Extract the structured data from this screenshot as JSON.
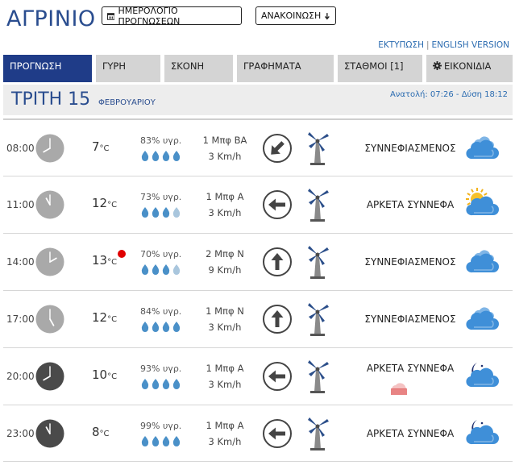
{
  "header": {
    "city": "ΑΓΡΙΝΙΟ",
    "calendar_button": "ΗΜΕΡΟΛΟΓΙΟ ΠΡΟΓΝΩΣΕΩΝ",
    "announce_button": "ΑΝΑΚΟΙΝΩΣΗ",
    "print_link": "ΕΚΤΥΠΩΣΗ",
    "separator": "|",
    "english_link": "ENGLISH VERSION"
  },
  "tabs": [
    {
      "label": "ΠΡΟΓΝΩΣΗ",
      "icon": "",
      "active": true
    },
    {
      "label": "ΓΥΡΗ",
      "icon": "",
      "active": false
    },
    {
      "label": "ΣΚΟΝΗ",
      "icon": "",
      "active": false
    },
    {
      "label": "ΓΡΑΦΗΜΑΤΑ",
      "icon": "",
      "active": false
    },
    {
      "label": "ΣΤΑΘΜΟΙ  [1]",
      "icon": "",
      "active": false
    },
    {
      "label": "ΕΙΚΟΝΙΔΙΑ",
      "icon": "gear-icon",
      "active": false
    }
  ],
  "day": {
    "name": "ΤΡΙΤΗ 15",
    "month": "ΦΕΒΡΟΥΑΡΙΟΥ",
    "sun": "Ανατολή: 07:26 - Δύση 18:12"
  },
  "temp_unit": "°C",
  "rows": [
    {
      "time": "08:00",
      "night": false,
      "temp": "7",
      "alert": false,
      "humidity": "83% υγρ.",
      "drops_full": 4,
      "wind_force": "1 Μπφ ΒΑ",
      "wind_speed": "3 Km/h",
      "arrow_icon": "arrow-southwest-icon",
      "condition": "ΣΥΝΝΕΦΙΑΣΜΕΝΟΣ",
      "haze": false,
      "weather_icon": "cloudy-icon"
    },
    {
      "time": "11:00",
      "night": false,
      "temp": "12",
      "alert": false,
      "humidity": "73% υγρ.",
      "drops_full": 3,
      "wind_force": "1 Μπφ Α",
      "wind_speed": "3 Km/h",
      "arrow_icon": "arrow-west-icon",
      "condition": "ΑΡΚΕΤΑ ΣΥΝΝΕΦΑ",
      "haze": false,
      "weather_icon": "sun-cloud-icon"
    },
    {
      "time": "14:00",
      "night": false,
      "temp": "13",
      "alert": true,
      "humidity": "70% υγρ.",
      "drops_full": 3,
      "wind_force": "2 Μπφ Ν",
      "wind_speed": "9 Km/h",
      "arrow_icon": "arrow-north-icon",
      "condition": "ΣΥΝΝΕΦΙΑΣΜΕΝΟΣ",
      "haze": false,
      "weather_icon": "cloudy-icon"
    },
    {
      "time": "17:00",
      "night": false,
      "temp": "12",
      "alert": false,
      "humidity": "84% υγρ.",
      "drops_full": 4,
      "wind_force": "1 Μπφ Ν",
      "wind_speed": "3 Km/h",
      "arrow_icon": "arrow-north-icon",
      "condition": "ΣΥΝΝΕΦΙΑΣΜΕΝΟΣ",
      "haze": false,
      "weather_icon": "cloudy-icon"
    },
    {
      "time": "20:00",
      "night": true,
      "temp": "10",
      "alert": false,
      "humidity": "93% υγρ.",
      "drops_full": 4,
      "wind_force": "1 Μπφ Α",
      "wind_speed": "3 Km/h",
      "arrow_icon": "arrow-west-icon",
      "condition": "ΑΡΚΕΤΑ ΣΥΝΝΕΦΑ",
      "haze": true,
      "weather_icon": "moon-cloud-icon"
    },
    {
      "time": "23:00",
      "night": true,
      "temp": "8",
      "alert": false,
      "humidity": "99% υγρ.",
      "drops_full": 4,
      "wind_force": "1 Μπφ Α",
      "wind_speed": "3 Km/h",
      "arrow_icon": "arrow-west-icon",
      "condition": "ΑΡΚΕΤΑ ΣΥΝΝΕΦΑ",
      "haze": false,
      "weather_icon": "moon-cloud-icon"
    }
  ],
  "colors": {
    "brand_blue": "#2a4d8f",
    "active_tab": "#1f3c88",
    "link_blue": "#2a6bb0",
    "tab_grey": "#d4d4d4",
    "clock_day": "#a9a9a9",
    "clock_night": "#4a4a4a",
    "drop_blue": "#4a90c8",
    "cloud_blue": "#3f8fd8",
    "alert_red": "#e00000"
  }
}
